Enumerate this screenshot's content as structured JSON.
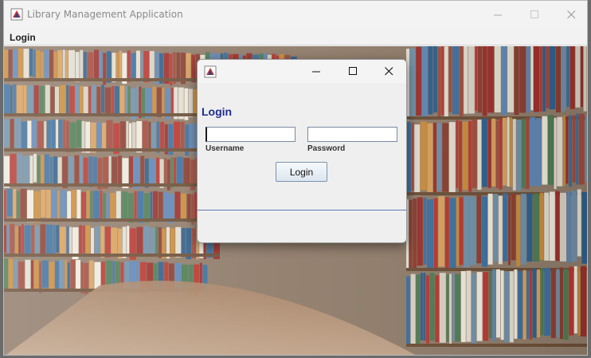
{
  "window": {
    "title": "Library Management Application",
    "controls": {
      "minimize": "—",
      "maximize": "☐",
      "close": "✕"
    }
  },
  "menubar": {
    "items": [
      {
        "label": "Login"
      }
    ]
  },
  "dialog": {
    "controls": {
      "minimize": "—",
      "maximize": "☐",
      "close": "✕"
    },
    "heading": "Login",
    "username": {
      "label": "Username",
      "value": ""
    },
    "password": {
      "label": "Password",
      "value": ""
    },
    "submit_label": "Login"
  },
  "colors": {
    "heading": "#1e2d8f",
    "divider": "#5f7ab7",
    "dialog_bg": "#efefef"
  }
}
